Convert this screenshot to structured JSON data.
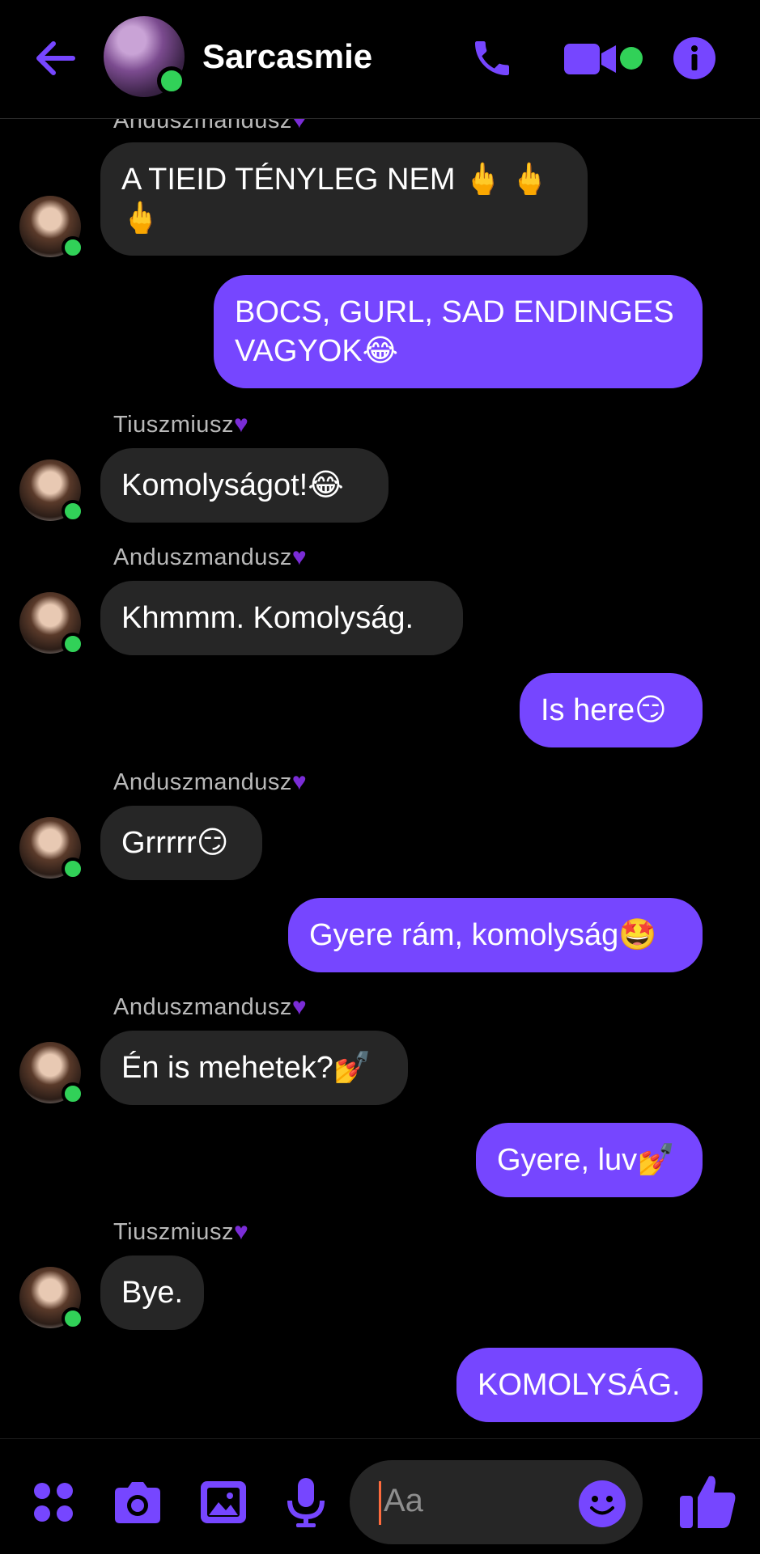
{
  "header": {
    "contact_name": "Sarcasmie",
    "icons": [
      "back-arrow-icon",
      "phone-icon",
      "video-camera-icon",
      "info-icon"
    ],
    "accent": "#7646ff",
    "online_color": "#31d158"
  },
  "messages": [
    {
      "dir": "in",
      "sender": "Anduszmandusz",
      "text": "A TIEID TÉNYLEG NEM 🖕 🖕\n🖕"
    },
    {
      "dir": "out",
      "text": "BOCS, GURL, SAD ENDINGES VAGYOK😂"
    },
    {
      "dir": "in",
      "sender": "Tiuszmiusz",
      "text": "Komolyságot!😂"
    },
    {
      "dir": "in",
      "sender": "Anduszmandusz",
      "text": "Khmmm. Komolyság."
    },
    {
      "dir": "out",
      "text": "Is here😏"
    },
    {
      "dir": "in",
      "sender": "Anduszmandusz",
      "text": "Grrrrr😏"
    },
    {
      "dir": "out",
      "text": "Gyere rám, komolyság🤩"
    },
    {
      "dir": "in",
      "sender": "Anduszmandusz",
      "text": "Én is mehetek?💅"
    },
    {
      "dir": "out",
      "text": "Gyere, luv💅"
    },
    {
      "dir": "in",
      "sender": "Tiuszmiusz",
      "text": "Bye."
    },
    {
      "dir": "out",
      "text": "KOMOLYSÁG."
    }
  ],
  "composer": {
    "placeholder": "Aa",
    "icons": [
      "apps-icon",
      "camera-icon",
      "gallery-icon",
      "microphone-icon",
      "emoji-icon",
      "thumbs-up-icon"
    ]
  },
  "colors": {
    "incoming_bubble": "#262626",
    "outgoing_bubble": "#7646ff",
    "sender_heart": "#7a2cd6"
  }
}
